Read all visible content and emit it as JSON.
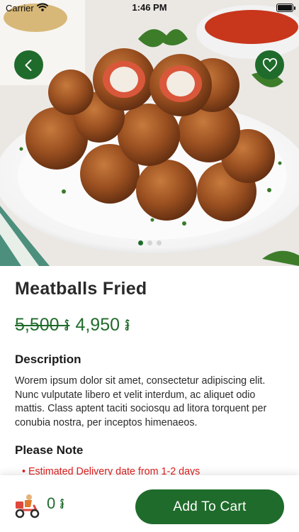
{
  "status_bar": {
    "carrier": "Carrier",
    "time": "1:46 PM",
    "icons": [
      "wifi-icon",
      "battery-icon"
    ]
  },
  "hero": {
    "image_subject": "meatballs-fried-photo",
    "carousel_pages": 3,
    "carousel_active": 1
  },
  "product": {
    "name": "Meatballs Fried",
    "old_price": "5,500 ៛",
    "new_price": "4,950 ៛"
  },
  "description": {
    "heading": "Description",
    "body": "Worem ipsum dolor sit amet, consectetur adipiscing elit. Nunc vulputate libero et velit interdum, ac aliquet odio mattis. Class aptent taciti sociosqu ad litora torquent per conubia nostra, per inceptos himenaeos."
  },
  "note": {
    "heading": "Please Note",
    "items": [
      "• Estimated Delivery date from 1-2 days"
    ]
  },
  "cart": {
    "total": "0 ៛",
    "add_label": "Add To Cart"
  },
  "colors": {
    "brand_green": "#1f6b2b",
    "note_red": "#e02020"
  }
}
